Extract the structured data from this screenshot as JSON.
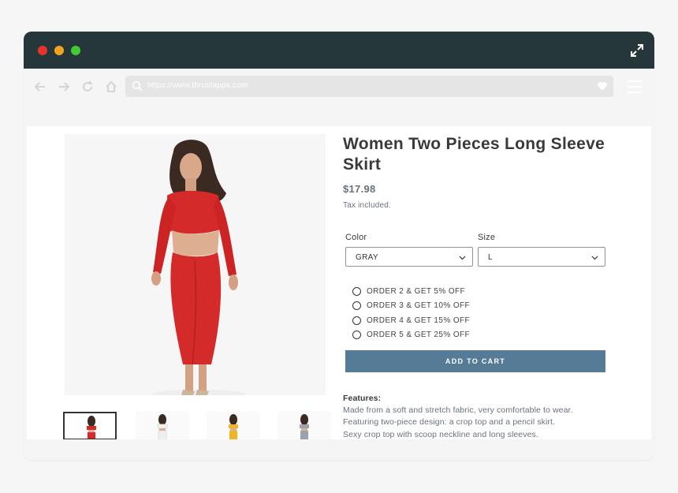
{
  "browser": {
    "url": "https://www.thrustapps.com"
  },
  "product": {
    "title": "Women Two Pieces Long Sleeve Skirt",
    "price": "$17.98",
    "tax_note": "Tax included."
  },
  "options": {
    "color": {
      "label": "Color",
      "value": "GRAY"
    },
    "size": {
      "label": "Size",
      "value": "L"
    }
  },
  "offers": [
    "ORDER 2 & GET 5% OFF",
    "ORDER 3 & GET 10% OFF",
    "ORDER 4 & GET 15% OFF",
    "ORDER 5 & GET 25% OFF"
  ],
  "cart_button": "ADD TO CART",
  "features": {
    "heading": "Features:",
    "lines": [
      "Made from a soft and stretch fabric, very comfortable to wear.",
      "Featuring two-piece design: a crop top and a pencil skirt.",
      "Sexy crop top with scoop neckline and long sleeves."
    ]
  },
  "colors": {
    "titlebar": "#26373b",
    "accent_button": "#557b97",
    "dress_red": "#d42a2a"
  }
}
